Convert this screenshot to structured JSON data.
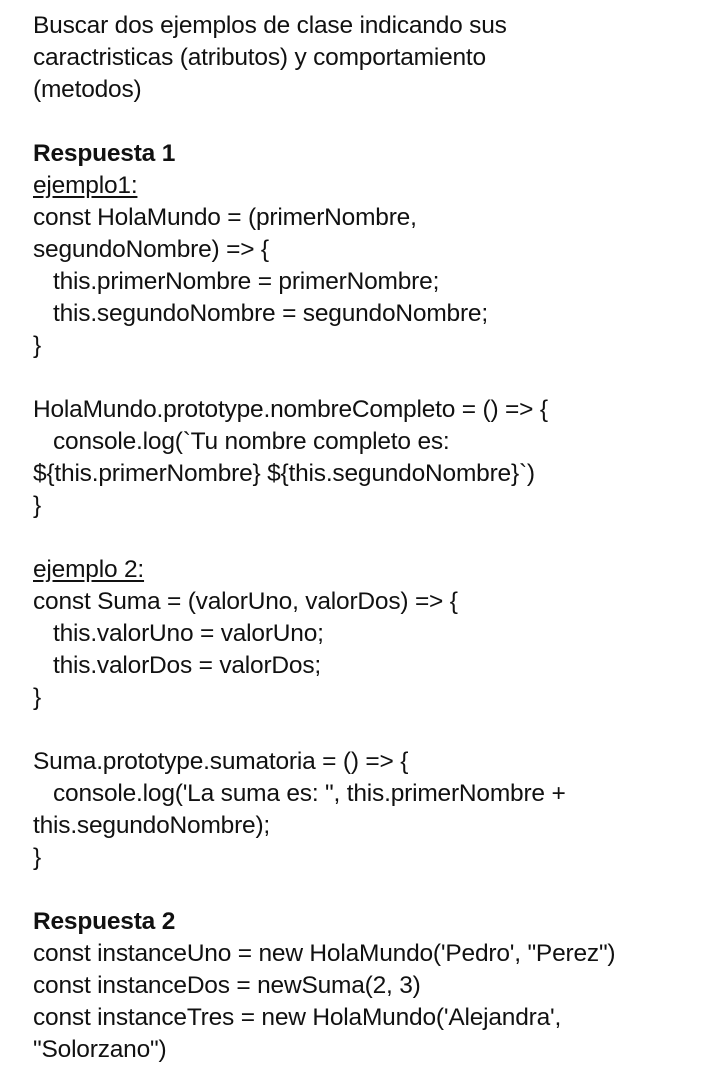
{
  "intro": [
    "Buscar dos ejemplos de clase indicando sus",
    "caractristicas (atributos) y comportamiento",
    "(metodos)"
  ],
  "respuesta1": {
    "heading": "Respuesta 1",
    "ejemplo1": {
      "label": "ejemplo1:",
      "code": [
        "const HolaMundo = (primerNombre,",
        "segundoNombre) => {",
        "this.primerNombre = primerNombre;",
        "this.segundoNombre = segundoNombre;",
        "}",
        "",
        "HolaMundo.prototype.nombreCompleto = () => {",
        "console.log(`Tu nombre completo es:",
        "${this.primerNombre} ${this.segundoNombre}`)",
        "}"
      ]
    },
    "ejemplo2": {
      "label": "ejemplo 2:",
      "code": [
        "const Suma = (valorUno, valorDos) => {",
        "this.valorUno = valorUno;",
        "this.valorDos = valorDos;",
        "}",
        "",
        "Suma.prototype.sumatoria = () => {",
        "console.log('La suma es: \", this.primerNombre +",
        "this.segundoNombre);",
        "}"
      ]
    }
  },
  "respuesta2": {
    "heading": "Respuesta 2",
    "code": [
      "const instanceUno = new HolaMundo('Pedro', \"Perez\")",
      "const instanceDos = newSuma(2, 3)",
      "const instanceTres = new HolaMundo('Alejandra',",
      "\"Solorzano\")"
    ]
  }
}
